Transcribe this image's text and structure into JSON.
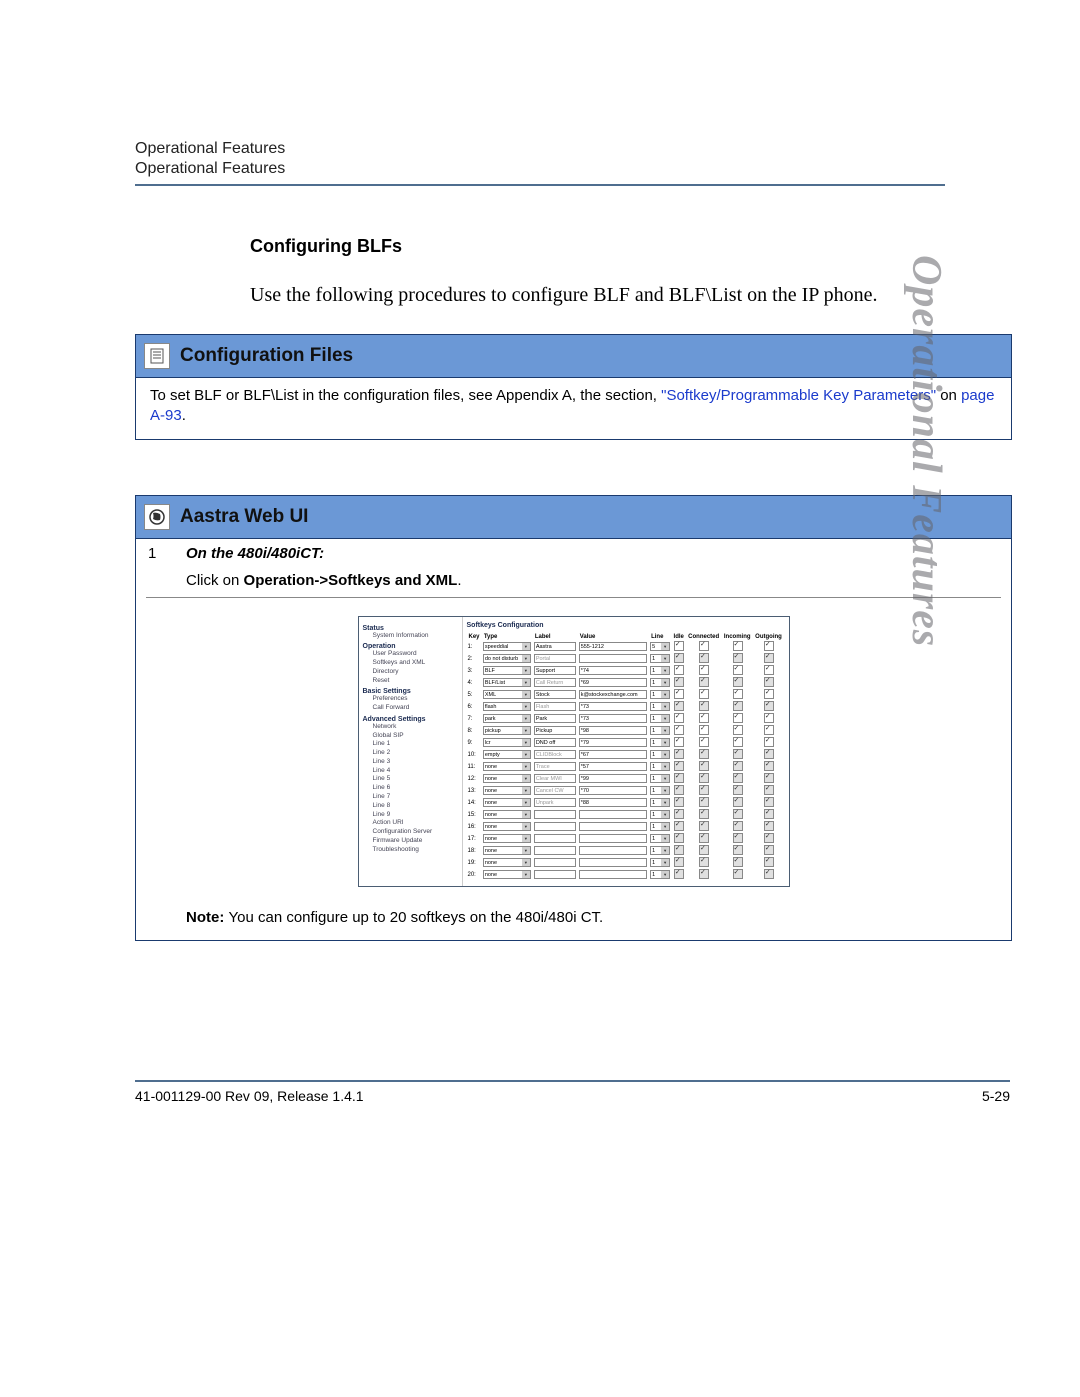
{
  "header": {
    "small": "Operational Features",
    "line": "Operational Features"
  },
  "section": {
    "title": "Configuring BLFs",
    "intro": "Use the following procedures to configure BLF and BLF\\List on the IP phone."
  },
  "configFiles": {
    "title": "Configuration Files",
    "text_pre": "To set BLF or BLF\\List in the configuration files, see Appendix A, the section, ",
    "link1": "\"Softkey/Programmable Key Parameters\"",
    "text_mid": " on ",
    "link2": "page A-93",
    "text_post": "."
  },
  "aastra": {
    "title": "Aastra Web UI",
    "step_num": "1",
    "step_device": "On the 480i/480iCT:",
    "step_click_pre": "Click on ",
    "step_click_bold": "Operation->Softkeys and XML",
    "step_click_post": ".",
    "note_pre": "Note: ",
    "note_body": "You can configure up to 20 softkeys on the 480i/480i CT."
  },
  "sidetab": "Operational Features",
  "footer": {
    "left": "41-001129-00 Rev 09, Release 1.4.1",
    "right": "5-29"
  },
  "screenshot": {
    "sidebar": {
      "sections": [
        {
          "head": "Status",
          "items": [
            "System Information"
          ]
        },
        {
          "head": "Operation",
          "items": [
            "User Password",
            "Softkeys and XML",
            "Directory",
            "Reset"
          ]
        },
        {
          "head": "Basic Settings",
          "items": [
            "Preferences",
            "Call Forward"
          ]
        },
        {
          "head": "Advanced Settings",
          "items": [
            "Network",
            "Global SIP",
            "Line 1",
            "Line 2",
            "Line 3",
            "Line 4",
            "Line 5",
            "Line 6",
            "Line 7",
            "Line 8",
            "Line 9",
            "Action URI",
            "Configuration Server",
            "Firmware Update",
            "Troubleshooting"
          ]
        }
      ]
    },
    "main": {
      "title": "Softkeys Configuration",
      "headers": [
        "Key",
        "Type",
        "Label",
        "Value",
        "Line",
        "Idle",
        "Connected",
        "Incoming",
        "Outgoing"
      ],
      "rows": [
        {
          "key": "1",
          "type": "speeddial",
          "label": "Aastra",
          "value": "555-1212",
          "line": "5",
          "idle": true,
          "conn": true,
          "inc": true,
          "out": true,
          "dim": false
        },
        {
          "key": "2",
          "type": "do not disturb",
          "label": "Portal",
          "value": "",
          "line": "1",
          "idle": true,
          "conn": true,
          "inc": true,
          "out": true,
          "dim": true
        },
        {
          "key": "3",
          "type": "BLF",
          "label": "Support",
          "value": "*74",
          "line": "1",
          "idle": true,
          "conn": true,
          "inc": true,
          "out": true,
          "dim": false
        },
        {
          "key": "4",
          "type": "BLF/List",
          "label": "Call Return",
          "value": "*69",
          "line": "1",
          "idle": true,
          "conn": true,
          "inc": true,
          "out": true,
          "dim": true
        },
        {
          "key": "5",
          "type": "XML",
          "label": "Stock",
          "value": "k@stockexchange.com",
          "line": "1",
          "idle": true,
          "conn": true,
          "inc": true,
          "out": true,
          "dim": false
        },
        {
          "key": "6",
          "type": "flash",
          "label": "Flash",
          "value": "*73",
          "line": "1",
          "idle": true,
          "conn": true,
          "inc": true,
          "out": true,
          "dim": true
        },
        {
          "key": "7",
          "type": "park",
          "label": "Park",
          "value": "*73",
          "line": "1",
          "idle": true,
          "conn": true,
          "inc": true,
          "out": true,
          "dim": false
        },
        {
          "key": "8",
          "type": "pickup",
          "label": "Pickup",
          "value": "*98",
          "line": "1",
          "idle": true,
          "conn": true,
          "inc": true,
          "out": true,
          "dim": false
        },
        {
          "key": "9",
          "type": "lcr",
          "label": "DND off",
          "value": "*79",
          "line": "1",
          "idle": true,
          "conn": true,
          "inc": true,
          "out": true,
          "dim": false
        },
        {
          "key": "10",
          "type": "empty",
          "label": "CLIDBlock",
          "value": "*67",
          "line": "1",
          "idle": true,
          "conn": true,
          "inc": true,
          "out": true,
          "dim": true
        },
        {
          "key": "11",
          "type": "none",
          "label": "Trace",
          "value": "*57",
          "line": "1",
          "idle": true,
          "conn": true,
          "inc": true,
          "out": true,
          "dim": true
        },
        {
          "key": "12",
          "type": "none",
          "label": "Clear MWI",
          "value": "*99",
          "line": "1",
          "idle": true,
          "conn": true,
          "inc": true,
          "out": true,
          "dim": true
        },
        {
          "key": "13",
          "type": "none",
          "label": "Cancel CW",
          "value": "*70",
          "line": "1",
          "idle": true,
          "conn": true,
          "inc": true,
          "out": true,
          "dim": true
        },
        {
          "key": "14",
          "type": "none",
          "label": "Unpark",
          "value": "*88",
          "line": "1",
          "idle": true,
          "conn": true,
          "inc": true,
          "out": true,
          "dim": true
        },
        {
          "key": "15",
          "type": "none",
          "label": "",
          "value": "",
          "line": "1",
          "idle": true,
          "conn": true,
          "inc": true,
          "out": true,
          "dim": true
        },
        {
          "key": "16",
          "type": "none",
          "label": "",
          "value": "",
          "line": "1",
          "idle": true,
          "conn": true,
          "inc": true,
          "out": true,
          "dim": true
        },
        {
          "key": "17",
          "type": "none",
          "label": "",
          "value": "",
          "line": "1",
          "idle": true,
          "conn": true,
          "inc": true,
          "out": true,
          "dim": true
        },
        {
          "key": "18",
          "type": "none",
          "label": "",
          "value": "",
          "line": "1",
          "idle": true,
          "conn": true,
          "inc": true,
          "out": true,
          "dim": true
        },
        {
          "key": "19",
          "type": "none",
          "label": "",
          "value": "",
          "line": "1",
          "idle": true,
          "conn": true,
          "inc": true,
          "out": true,
          "dim": true
        },
        {
          "key": "20",
          "type": "none",
          "label": "",
          "value": "",
          "line": "1",
          "idle": true,
          "conn": true,
          "inc": true,
          "out": true,
          "dim": true
        }
      ]
    }
  }
}
